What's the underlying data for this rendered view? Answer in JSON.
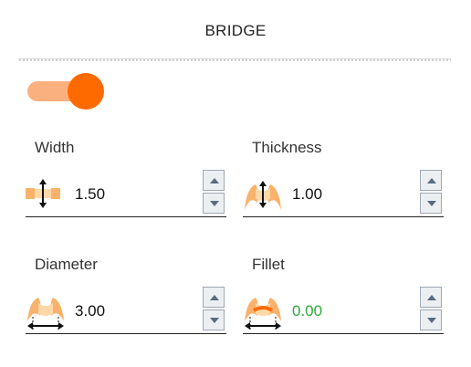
{
  "panel": {
    "title": "BRIDGE",
    "toggle": {
      "state": "on",
      "track_color": "#fbb07f",
      "knob_color": "#ff6a00"
    }
  },
  "fields": {
    "width": {
      "label": "Width",
      "value": "1.50",
      "icon": "width-arrows-icon"
    },
    "thickness": {
      "label": "Thickness",
      "value": "1.00",
      "icon": "thickness-arrows-icon"
    },
    "diameter": {
      "label": "Diameter",
      "value": "3.00",
      "icon": "diameter-arrows-icon"
    },
    "fillet": {
      "label": "Fillet",
      "value": "0.00",
      "value_color": "#2eaa3c",
      "icon": "fillet-icon"
    }
  },
  "spinner": {
    "up_icon": "triangle-up-icon",
    "down_icon": "triangle-down-icon"
  }
}
